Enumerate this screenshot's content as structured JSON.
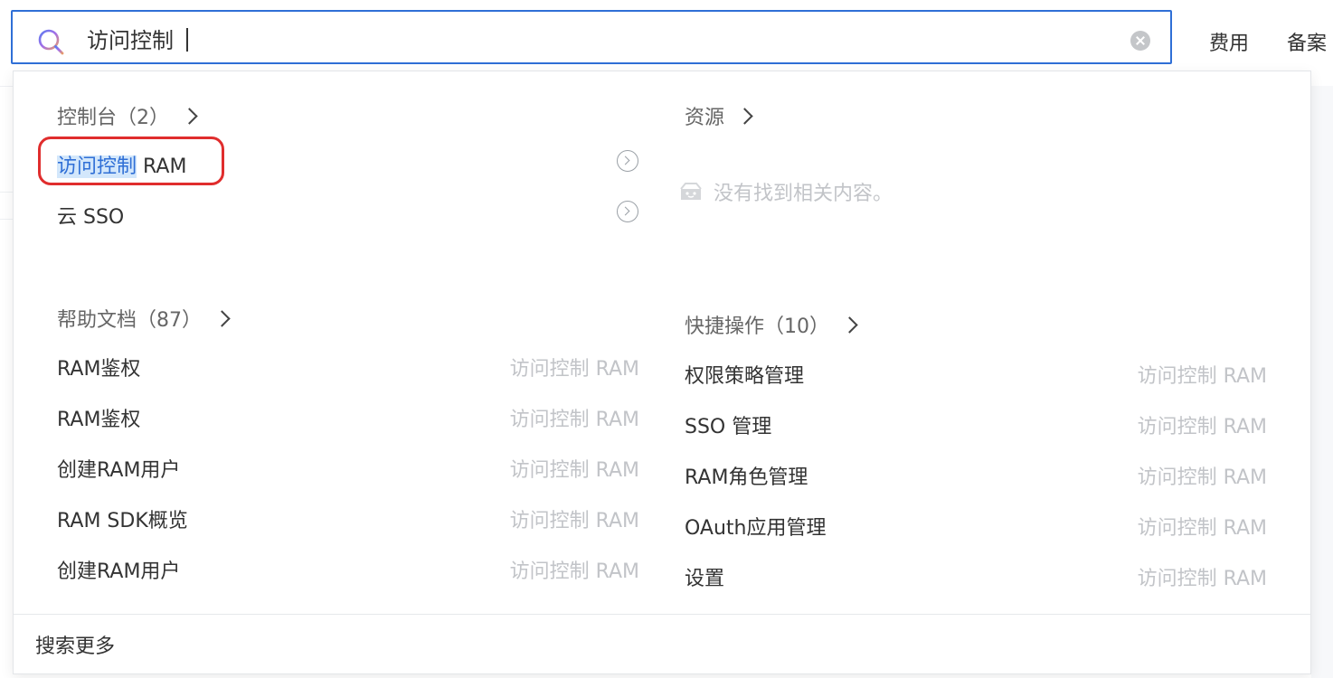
{
  "search": {
    "value": "访问控制",
    "placeholder": ""
  },
  "topnav": [
    "费用",
    "备案"
  ],
  "console": {
    "title": "控制台（2）",
    "items": [
      {
        "label_highlight": "访问控制",
        "label_rest": " RAM"
      },
      {
        "label_highlight": "",
        "label_rest": "云 SSO"
      }
    ]
  },
  "resources": {
    "title": "资源",
    "empty_text": "没有找到相关内容。"
  },
  "docs": {
    "title": "帮助文档（87）",
    "items": [
      {
        "label": "RAM鉴权",
        "tag": "访问控制 RAM"
      },
      {
        "label": "RAM鉴权",
        "tag": "访问控制 RAM"
      },
      {
        "label": "创建RAM用户",
        "tag": "访问控制 RAM"
      },
      {
        "label": "RAM SDK概览",
        "tag": "访问控制 RAM"
      },
      {
        "label": "创建RAM用户",
        "tag": "访问控制 RAM"
      }
    ]
  },
  "quick_actions": {
    "title": "快捷操作（10）",
    "items": [
      {
        "label": "权限策略管理",
        "tag": "访问控制 RAM"
      },
      {
        "label": "SSO 管理",
        "tag": "访问控制 RAM"
      },
      {
        "label": "RAM角色管理",
        "tag": "访问控制 RAM"
      },
      {
        "label": "OAuth应用管理",
        "tag": "访问控制 RAM"
      },
      {
        "label": "设置",
        "tag": "访问控制 RAM"
      }
    ]
  },
  "footer": {
    "search_more": "搜索更多"
  },
  "colors": {
    "accent": "#2f6fd6",
    "highlight_border": "#e02d2d",
    "muted": "#c2c4c8"
  }
}
